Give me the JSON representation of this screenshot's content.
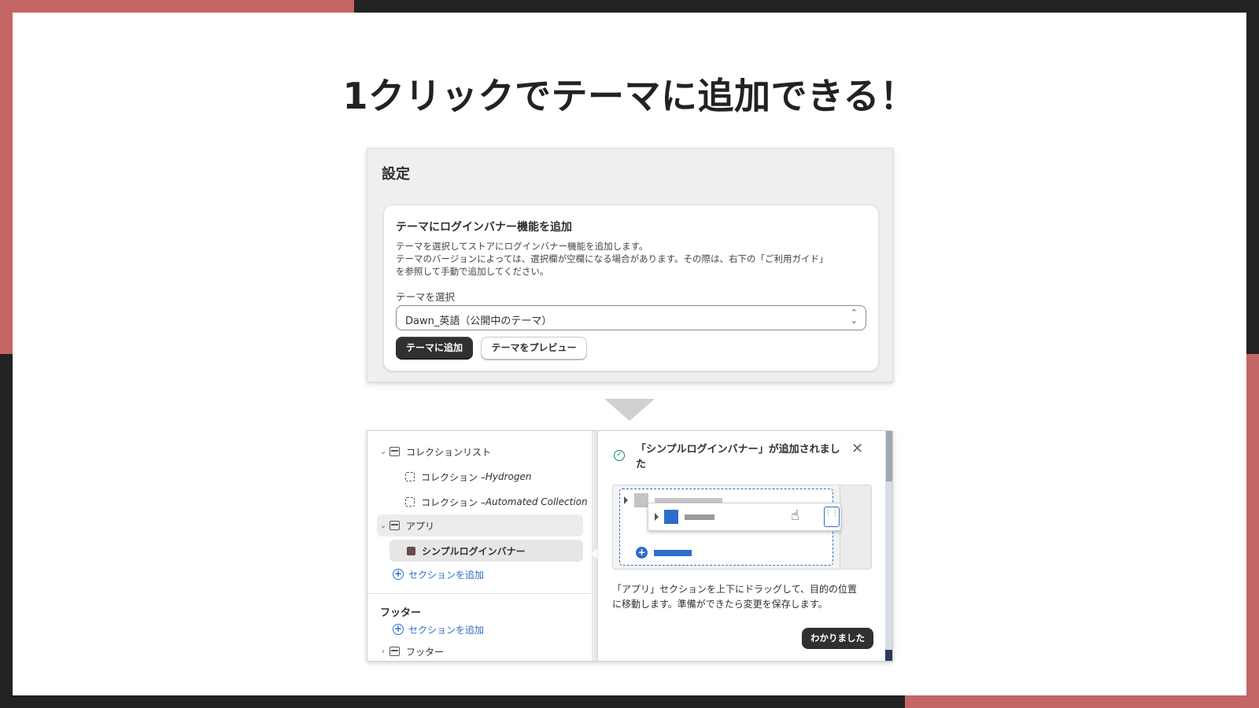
{
  "frame": {
    "accent": "#c46666",
    "dark": "#222222"
  },
  "headline": "1クリックでテーマに追加できる！",
  "settings_panel": {
    "title": "設定",
    "card_title": "テーマにログインバナー機能を追加",
    "description_lines": [
      "テーマを選択してストアにログインバナー機能を追加します。",
      "テーマのバージョンによっては、選択欄が空欄になる場合があります。その際は、右下の「ご利用ガイド」",
      "を参照して手動で追加してください。"
    ],
    "select_label": "テーマを選択",
    "select_value": "Dawn_英語（公開中のテーマ）",
    "primary_button": "テーマに追加",
    "secondary_button": "テーマをプレビュー"
  },
  "editor": {
    "tree": {
      "collection_list": "コレクションリスト",
      "collection_prefix": "コレクション – ",
      "collection_1": "Hydrogen",
      "collection_2": "Automated Collection",
      "apps": "アプリ",
      "app_block": "シンプルログインバナー",
      "add_section": "セクションを追加",
      "footer_heading": "フッター",
      "footer_add_section": "セクションを追加",
      "footer_item": "フッター"
    },
    "popover": {
      "title": "「シンプルログインバナー」が追加されました",
      "body_lines": [
        "「アプリ」セクションを上下にドラッグして、目的の位置",
        "に移動します。準備ができたら変更を保存します。"
      ],
      "ok_button": "わかりました"
    }
  },
  "icons": [
    "check-circle-icon",
    "close-icon",
    "chevron-down-icon",
    "chevron-right-icon",
    "section-icon",
    "block-icon",
    "app-icon",
    "plus-circle-icon",
    "drag-handle-icon",
    "hand-cursor-icon",
    "select-chevron-icon"
  ],
  "colors": {
    "primary_button": "#303030",
    "link_blue": "#2c6ecb",
    "success_green": "#1a8a5a"
  }
}
